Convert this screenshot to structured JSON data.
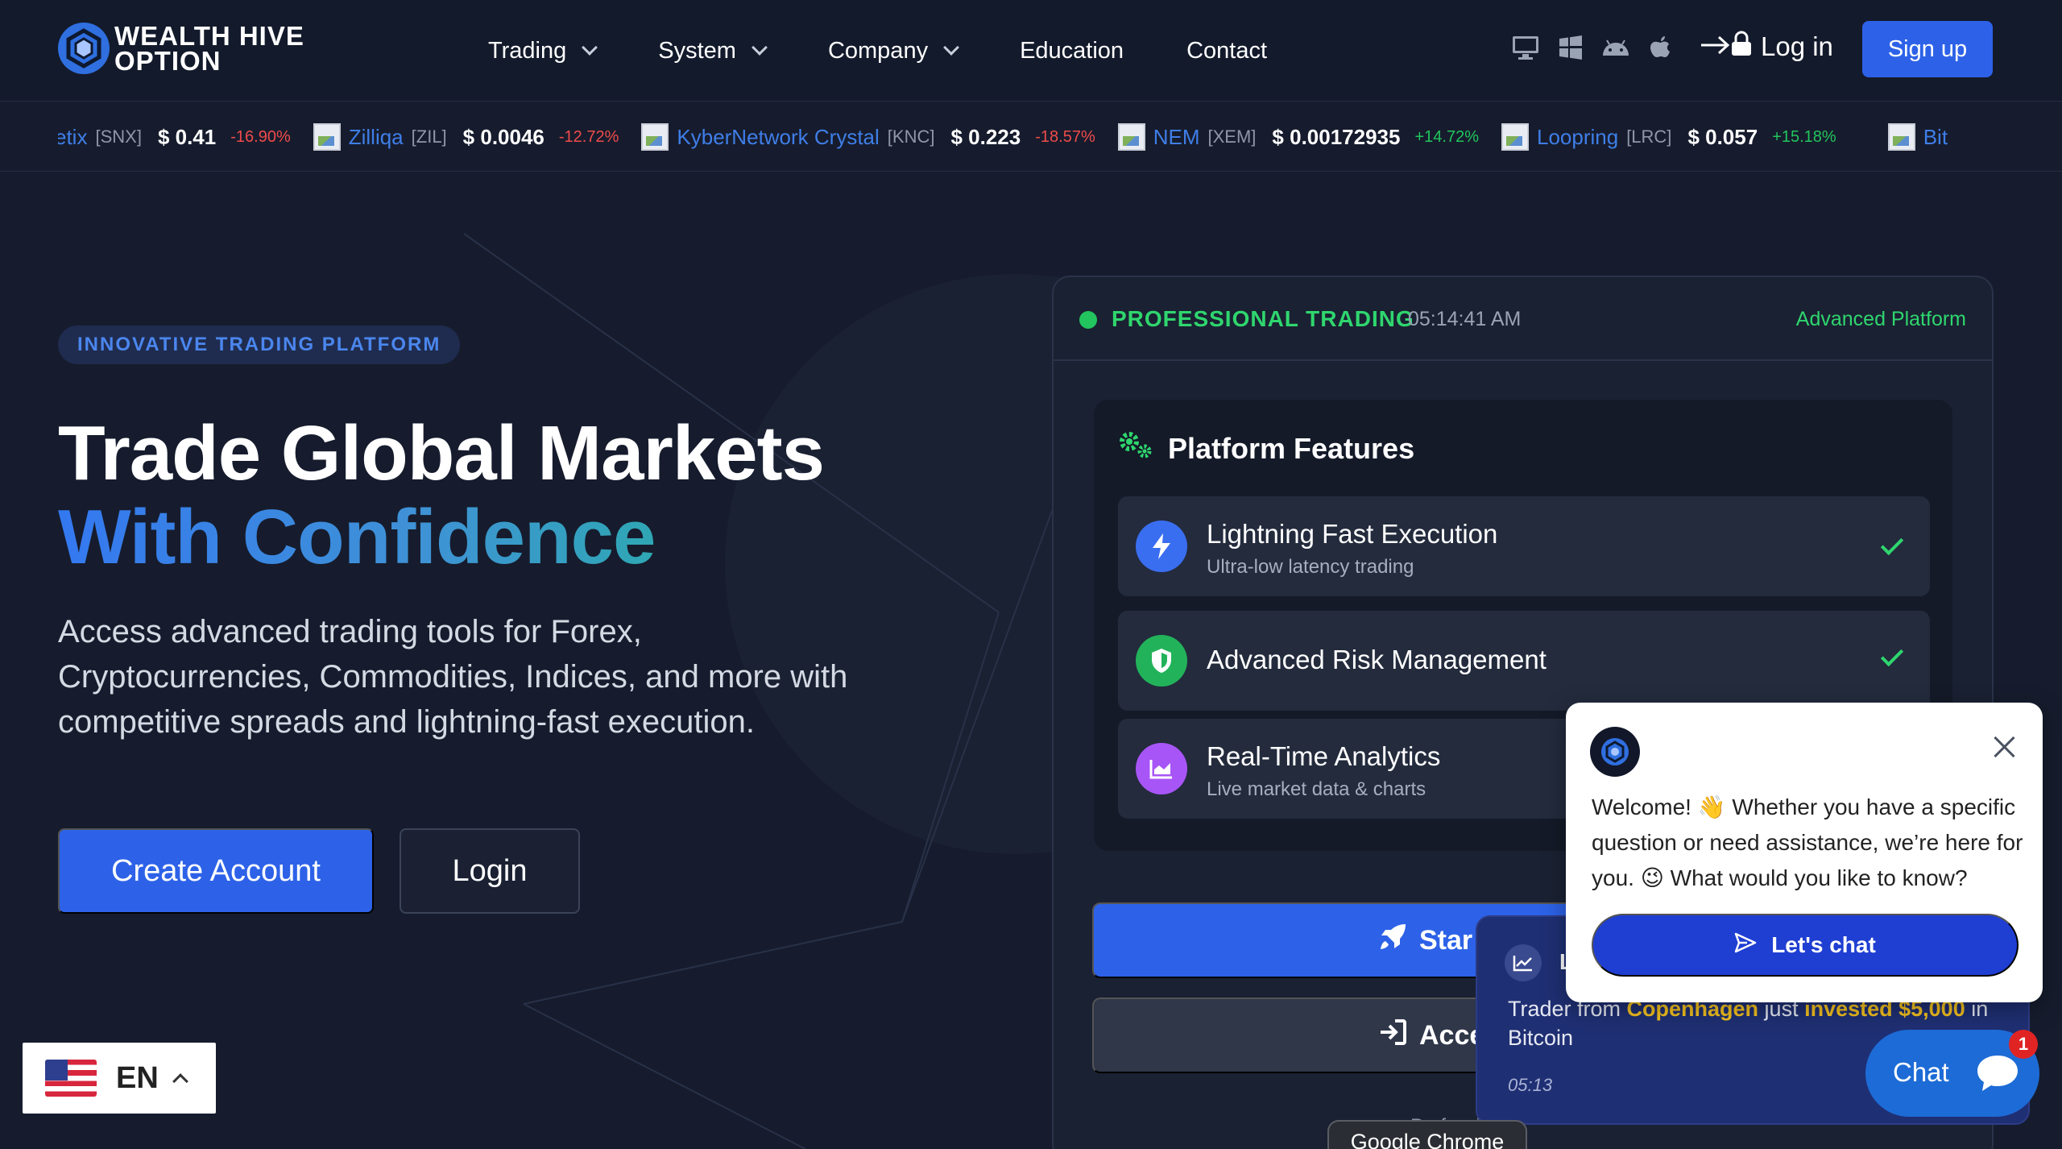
{
  "brand": {
    "line1": "WEALTH HIVE",
    "line2": "OPTION"
  },
  "nav": {
    "items": [
      {
        "label": "Trading",
        "dropdown": true
      },
      {
        "label": "System",
        "dropdown": true
      },
      {
        "label": "Company",
        "dropdown": true
      },
      {
        "label": "Education",
        "dropdown": false
      },
      {
        "label": "Contact",
        "dropdown": false
      }
    ],
    "platform_icons": [
      "desktop-icon",
      "windows-icon",
      "android-icon",
      "apple-icon"
    ],
    "login_label": "Log in",
    "signup_label": "Sign up"
  },
  "ticker": [
    {
      "name": "etix",
      "symbol": "[SNX]",
      "price": "$ 0.41",
      "change": "-16.90%",
      "direction": "down"
    },
    {
      "name": "Zilliqa",
      "symbol": "[ZIL]",
      "price": "$ 0.0046",
      "change": "-12.72%",
      "direction": "down"
    },
    {
      "name": "KyberNetwork Crystal",
      "symbol": "[KNC]",
      "price": "$ 0.223",
      "change": "-18.57%",
      "direction": "down"
    },
    {
      "name": "NEM",
      "symbol": "[XEM]",
      "price": "$ 0.00172935",
      "change": "+14.72%",
      "direction": "up"
    },
    {
      "name": "Loopring",
      "symbol": "[LRC]",
      "price": "$ 0.057",
      "change": "+15.18%",
      "direction": "up"
    },
    {
      "name": "Bit",
      "symbol": "",
      "price": "",
      "change": "",
      "direction": "up"
    }
  ],
  "hero": {
    "badge": "INNOVATIVE TRADING PLATFORM",
    "title_line1": "Trade Global Markets",
    "title_line2": "With Confidence",
    "lead": "Access advanced trading tools for Forex, Cryptocurrencies, Commodities, Indices, and more with competitive spreads and lightning-fast execution.",
    "create_label": "Create Account",
    "login_label": "Login"
  },
  "panel": {
    "status": "PROFESSIONAL TRADING",
    "time": "05:14:41 AM",
    "tag": "Advanced Platform",
    "features_title": "Platform Features",
    "features": [
      {
        "name": "Lightning Fast Execution",
        "sub": "Ultra-low latency trading",
        "icon": "lightning-icon",
        "color": "#3a6ef0"
      },
      {
        "name": "Advanced Risk Management",
        "sub": "",
        "icon": "shield-icon",
        "color": "#22b35a"
      },
      {
        "name": "Real-Time Analytics",
        "sub": "Live market data & charts",
        "icon": "chart-icon",
        "color": "#a855f7"
      }
    ],
    "btn_primary": "Star",
    "btn_secondary": "Acce",
    "footer": "re • Professional"
  },
  "toast": {
    "title": "L",
    "text_pre": "Trader from ",
    "city": "Copenhagen",
    "text_mid": " just ",
    "action": "invested $5,000",
    "text_post": " in Bitcoin",
    "time": "05:13"
  },
  "chat": {
    "message": "Welcome! 👋 Whether you have a specific question or need assistance, we’re here for you. 😉 What would you like to know?",
    "cta": "Let's chat",
    "launcher_label": "Chat",
    "badge": "1"
  },
  "language": {
    "code": "EN"
  },
  "tooltip": "Google Chrome",
  "colors": {
    "accent": "#2d62e8",
    "success": "#22c55e",
    "background": "#161c2d"
  }
}
